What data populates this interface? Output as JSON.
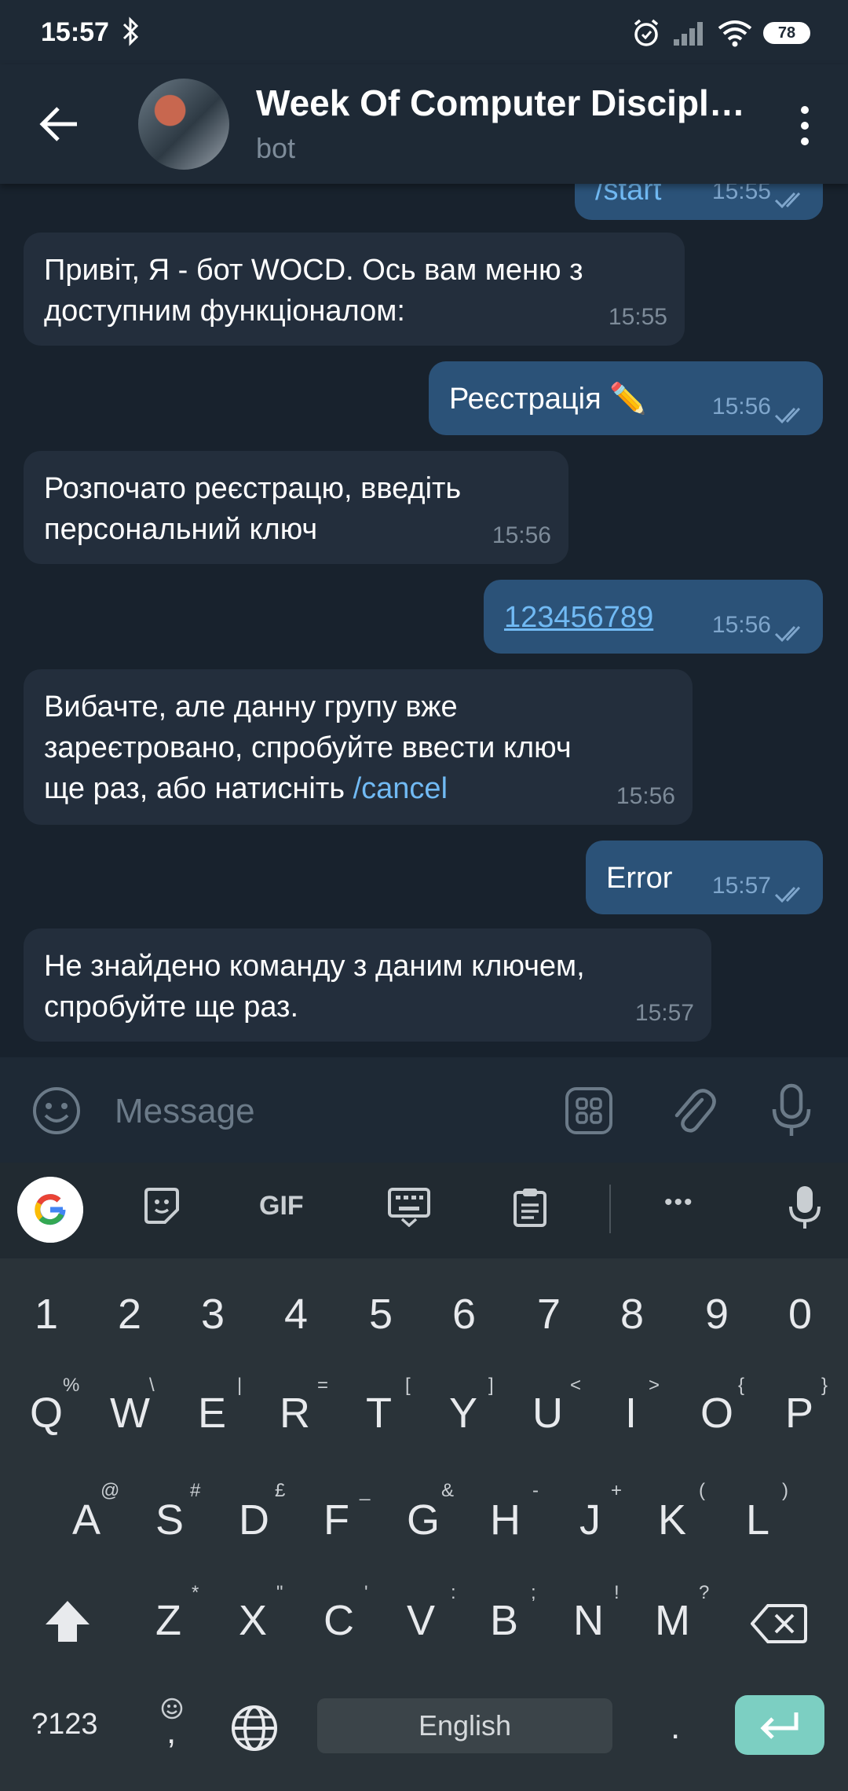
{
  "status": {
    "time": "15:57",
    "battery": "78"
  },
  "header": {
    "title": "Week Of Computer Discipl…",
    "subtitle": "bot"
  },
  "messages": [
    {
      "dir": "out",
      "text": "/start",
      "time": "15:55"
    },
    {
      "dir": "in",
      "line1": "Привіт, Я - бот WOCD. Ось вам меню з",
      "line2": "доступним функціоналом:",
      "time": "15:55"
    },
    {
      "dir": "out",
      "text": "Реєстрація ✏️",
      "time": "15:56"
    },
    {
      "dir": "in",
      "line1": "Розпочато реєстрацю, введіть",
      "line2": "персональний ключ",
      "time": "15:56"
    },
    {
      "dir": "out",
      "text": "123456789",
      "time": "15:56"
    },
    {
      "dir": "in",
      "line1": "Вибачте, але данну групу вже",
      "line2": "зареєтровано, спробуйте ввести ключ",
      "line3": "ще раз, або натисніть ",
      "link": "/cancel",
      "time": "15:56"
    },
    {
      "dir": "out",
      "text": "Error",
      "time": "15:57"
    },
    {
      "dir": "in",
      "line1": "Не знайдено команду з даним ключем,",
      "line2": "спробуйте ще раз.",
      "time": "15:57"
    }
  ],
  "input": {
    "placeholder": "Message"
  },
  "keyboard": {
    "toolbar": {
      "gif": "GIF",
      "more": "•••"
    },
    "numbers": [
      "1",
      "2",
      "3",
      "4",
      "5",
      "6",
      "7",
      "8",
      "9",
      "0"
    ],
    "row1": [
      "Q",
      "W",
      "E",
      "R",
      "T",
      "Y",
      "U",
      "I",
      "O",
      "P"
    ],
    "row1_hints": [
      "%",
      "\\",
      "|",
      "=",
      "[",
      "]",
      "<",
      ">",
      "{",
      "}"
    ],
    "row2": [
      "A",
      "S",
      "D",
      "F",
      "G",
      "H",
      "J",
      "K",
      "L"
    ],
    "row2_hints": [
      "@",
      "#",
      "£",
      "_",
      "&",
      "-",
      "+",
      "(",
      ")"
    ],
    "row3": [
      "Z",
      "X",
      "C",
      "V",
      "B",
      "N",
      "M"
    ],
    "row3_hints": [
      "*",
      "\"",
      "'",
      ":",
      ";",
      "!",
      "?"
    ],
    "symbols_key": "?123",
    "comma_key": ",",
    "space_label": "English",
    "period_key": "."
  }
}
